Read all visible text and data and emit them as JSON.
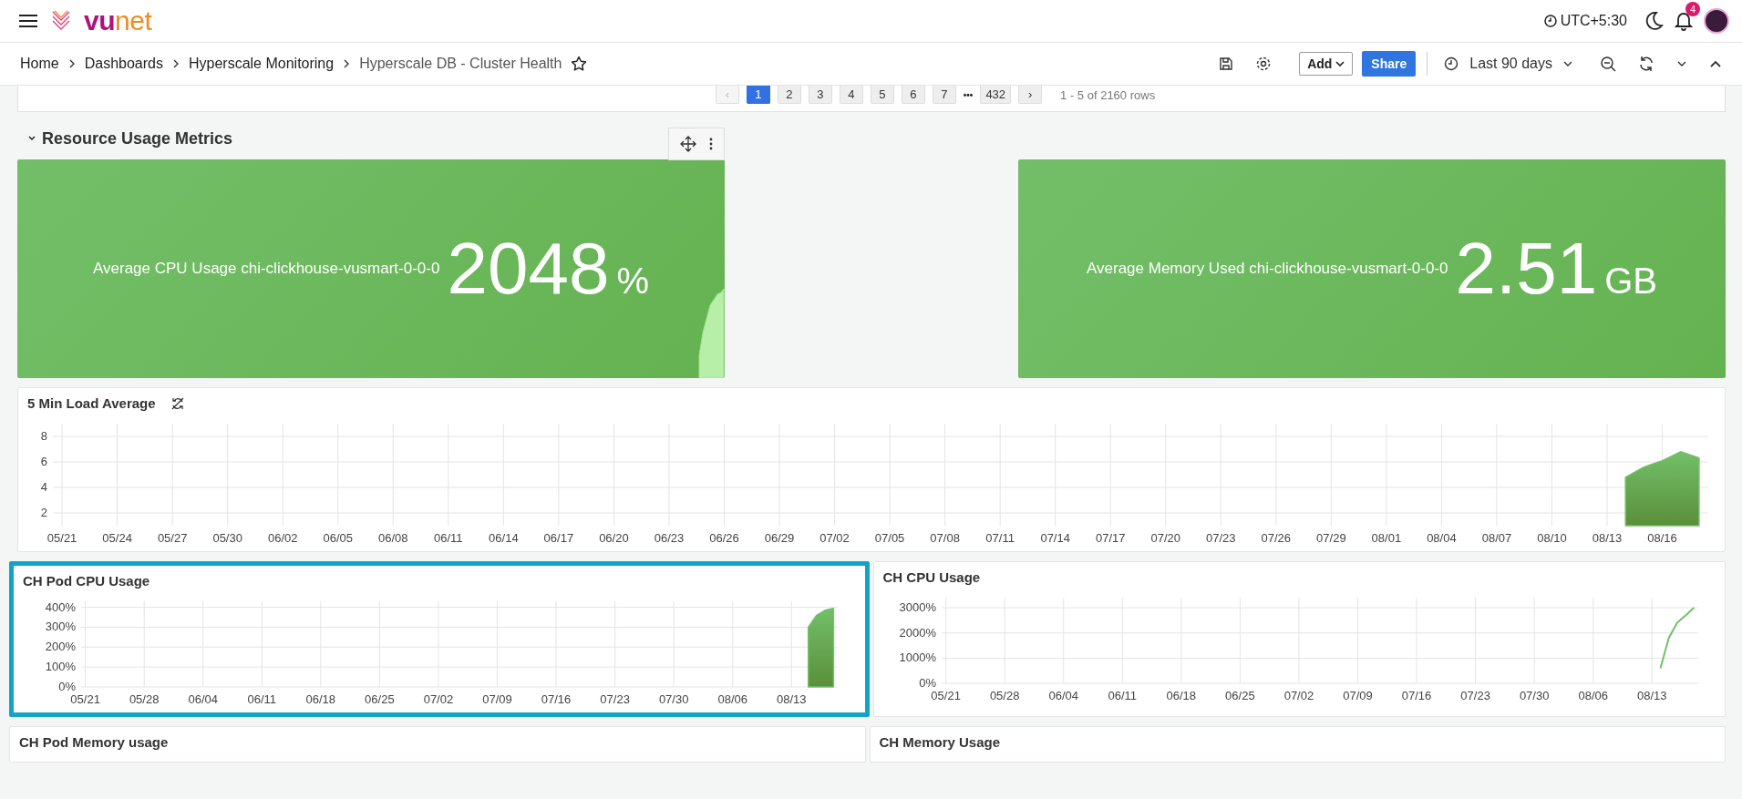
{
  "topbar": {
    "logo": {
      "part_1": "vu",
      "part_2": "net"
    },
    "timezone": "UTC+5:30",
    "notifications": "4"
  },
  "breadcrumb": {
    "items": [
      "Home",
      "Dashboards",
      "Hyperscale Monitoring"
    ],
    "current": "Hyperscale DB - Cluster Health"
  },
  "toolbar": {
    "add": "Add",
    "share": "Share",
    "time_range": "Last 90 days"
  },
  "pagination": {
    "prev": "‹",
    "pages": [
      {
        "label": "1",
        "selected": true
      },
      {
        "label": "2",
        "selected": false
      },
      {
        "label": "3",
        "selected": false
      },
      {
        "label": "4",
        "selected": false
      },
      {
        "label": "5",
        "selected": false
      },
      {
        "label": "6",
        "selected": false
      },
      {
        "label": "7",
        "selected": false
      }
    ],
    "ellipsis": "•••",
    "last": "432",
    "next": "›",
    "summary": "1 - 5 of 2160 rows"
  },
  "row": {
    "title": "Resource Usage Metrics",
    "expanded": true
  },
  "stats": [
    {
      "label": "Average CPU Usage chi-clickhouse-vusmart-0-0-0",
      "value": "2048",
      "unit": "%",
      "sparkline": true
    },
    {
      "label": "Average Memory Used chi-clickhouse-vusmart-0-0-0",
      "value": "2.51",
      "unit": "GB",
      "sparkline": false
    }
  ],
  "load_panel": {
    "title": "5 Min Load Average",
    "selected": false,
    "chart_data": {
      "type": "area",
      "grid": true,
      "ylim": [
        1,
        9
      ],
      "yticks": [
        2,
        4,
        6,
        8
      ],
      "categories": [
        "05/21",
        null,
        null,
        "05/24",
        null,
        null,
        "05/27",
        null,
        null,
        "05/30",
        null,
        null,
        "06/02",
        null,
        null,
        "06/05",
        null,
        null,
        "06/08",
        null,
        null,
        "06/11",
        null,
        null,
        "06/14",
        null,
        null,
        "06/17",
        null,
        null,
        "06/20",
        null,
        null,
        "06/23",
        null,
        null,
        "06/26",
        null,
        null,
        "06/29",
        null,
        null,
        "07/02",
        null,
        null,
        "07/05",
        null,
        null,
        "07/08",
        null,
        null,
        "07/11",
        null,
        null,
        "07/14",
        null,
        null,
        "07/17",
        null,
        null,
        "07/20",
        null,
        null,
        "07/23",
        null,
        null,
        "07/26",
        null,
        null,
        "07/29",
        null,
        null,
        "08/01",
        null,
        null,
        "08/04",
        null,
        null,
        "08/07",
        null,
        null,
        "08/10",
        null,
        null,
        "08/13",
        null,
        null,
        "08/16",
        null,
        null
      ],
      "series": [
        {
          "color": "#73bf69",
          "values": [
            null,
            null,
            null,
            null,
            null,
            null,
            null,
            null,
            null,
            null,
            null,
            null,
            null,
            null,
            null,
            null,
            null,
            null,
            null,
            null,
            null,
            null,
            null,
            null,
            null,
            null,
            null,
            null,
            null,
            null,
            null,
            null,
            null,
            null,
            null,
            null,
            null,
            null,
            null,
            null,
            null,
            null,
            null,
            null,
            null,
            null,
            null,
            null,
            null,
            null,
            null,
            null,
            null,
            null,
            null,
            null,
            null,
            null,
            null,
            null,
            null,
            null,
            null,
            null,
            null,
            null,
            null,
            null,
            null,
            null,
            null,
            null,
            null,
            null,
            null,
            null,
            null,
            null,
            null,
            null,
            null,
            null,
            null,
            null,
            null,
            4.8,
            5.6,
            6.1,
            6.8,
            6.3
          ]
        }
      ]
    }
  },
  "panels": [
    {
      "title": "CH Pod CPU Usage",
      "selected": true,
      "chart_data": {
        "type": "area",
        "grid": true,
        "ylim": [
          0,
          430
        ],
        "yticks": [
          {
            "value": 0,
            "label": "0%"
          },
          {
            "value": 100,
            "label": "100%"
          },
          {
            "value": 200,
            "label": "200%"
          },
          {
            "value": 300,
            "label": "300%"
          },
          {
            "value": 400,
            "label": "400%"
          }
        ],
        "categories": [
          "05/21",
          null,
          null,
          null,
          null,
          null,
          null,
          "05/28",
          null,
          null,
          null,
          null,
          null,
          null,
          "06/04",
          null,
          null,
          null,
          null,
          null,
          null,
          "06/11",
          null,
          null,
          null,
          null,
          null,
          null,
          "06/18",
          null,
          null,
          null,
          null,
          null,
          null,
          "06/25",
          null,
          null,
          null,
          null,
          null,
          null,
          "07/02",
          null,
          null,
          null,
          null,
          null,
          null,
          "07/09",
          null,
          null,
          null,
          null,
          null,
          null,
          "07/16",
          null,
          null,
          null,
          null,
          null,
          null,
          "07/23",
          null,
          null,
          null,
          null,
          null,
          null,
          "07/30",
          null,
          null,
          null,
          null,
          null,
          null,
          "08/06",
          null,
          null,
          null,
          null,
          null,
          null,
          "08/13",
          null,
          null,
          null,
          null,
          null
        ],
        "series": [
          {
            "color": "#73bf69",
            "values": [
              null,
              null,
              null,
              null,
              null,
              null,
              null,
              null,
              null,
              null,
              null,
              null,
              null,
              null,
              null,
              null,
              null,
              null,
              null,
              null,
              null,
              null,
              null,
              null,
              null,
              null,
              null,
              null,
              null,
              null,
              null,
              null,
              null,
              null,
              null,
              null,
              null,
              null,
              null,
              null,
              null,
              null,
              null,
              null,
              null,
              null,
              null,
              null,
              null,
              null,
              null,
              null,
              null,
              null,
              null,
              null,
              null,
              null,
              null,
              null,
              null,
              null,
              null,
              null,
              null,
              null,
              null,
              null,
              null,
              null,
              null,
              null,
              null,
              null,
              null,
              null,
              null,
              null,
              null,
              null,
              null,
              null,
              null,
              null,
              null,
              null,
              300,
              360,
              385,
              395
            ]
          }
        ]
      }
    },
    {
      "title": "CH CPU Usage",
      "selected": false,
      "chart_data": {
        "type": "line",
        "grid": true,
        "ylim": [
          0,
          3400
        ],
        "yticks": [
          {
            "value": 0,
            "label": "0%"
          },
          {
            "value": 1000,
            "label": "1000%"
          },
          {
            "value": 2000,
            "label": "2000%"
          },
          {
            "value": 3000,
            "label": "3000%"
          }
        ],
        "categories": [
          "05/21",
          null,
          null,
          null,
          null,
          null,
          null,
          "05/28",
          null,
          null,
          null,
          null,
          null,
          null,
          "06/04",
          null,
          null,
          null,
          null,
          null,
          null,
          "06/11",
          null,
          null,
          null,
          null,
          null,
          null,
          "06/18",
          null,
          null,
          null,
          null,
          null,
          null,
          "06/25",
          null,
          null,
          null,
          null,
          null,
          null,
          "07/02",
          null,
          null,
          null,
          null,
          null,
          null,
          "07/09",
          null,
          null,
          null,
          null,
          null,
          null,
          "07/16",
          null,
          null,
          null,
          null,
          null,
          null,
          "07/23",
          null,
          null,
          null,
          null,
          null,
          null,
          "07/30",
          null,
          null,
          null,
          null,
          null,
          null,
          "08/06",
          null,
          null,
          null,
          null,
          null,
          null,
          "08/13",
          null,
          null,
          null,
          null,
          null
        ],
        "series": [
          {
            "color": "#73bf69",
            "values": [
              null,
              null,
              null,
              null,
              null,
              null,
              null,
              null,
              null,
              null,
              null,
              null,
              null,
              null,
              null,
              null,
              null,
              null,
              null,
              null,
              null,
              null,
              null,
              null,
              null,
              null,
              null,
              null,
              null,
              null,
              null,
              null,
              null,
              null,
              null,
              null,
              null,
              null,
              null,
              null,
              null,
              null,
              null,
              null,
              null,
              null,
              null,
              null,
              null,
              null,
              null,
              null,
              null,
              null,
              null,
              null,
              null,
              null,
              null,
              null,
              null,
              null,
              null,
              null,
              null,
              null,
              null,
              null,
              null,
              null,
              null,
              null,
              null,
              null,
              null,
              null,
              null,
              null,
              null,
              null,
              null,
              null,
              null,
              null,
              null,
              600,
              1800,
              2400,
              2700,
              3000
            ]
          }
        ]
      }
    }
  ],
  "next_panels": [
    {
      "title": "CH Pod Memory usage",
      "selected": false
    },
    {
      "title": "CH Memory Usage",
      "selected": false
    }
  ]
}
